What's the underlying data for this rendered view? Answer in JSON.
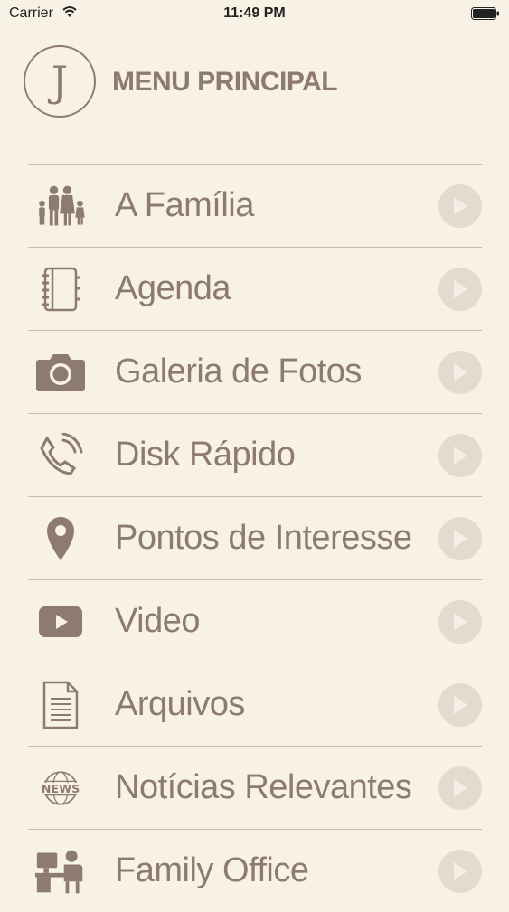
{
  "status_bar": {
    "carrier": "Carrier",
    "time": "11:49 PM"
  },
  "header": {
    "logo_letter": "J",
    "title": "MENU PRINCIPAL"
  },
  "menu": {
    "items": [
      {
        "label": "A Família",
        "icon": "family-icon"
      },
      {
        "label": "Agenda",
        "icon": "notebook-icon"
      },
      {
        "label": "Galeria de Fotos",
        "icon": "camera-icon"
      },
      {
        "label": "Disk Rápido",
        "icon": "phone-icon"
      },
      {
        "label": "Pontos de Interesse",
        "icon": "map-pin-icon"
      },
      {
        "label": "Video",
        "icon": "video-play-icon"
      },
      {
        "label": "Arquivos",
        "icon": "document-icon"
      },
      {
        "label": "Notícias Relevantes",
        "icon": "news-globe-icon",
        "icon_text": "NEWS"
      },
      {
        "label": "Family Office",
        "icon": "office-desk-icon"
      }
    ]
  },
  "colors": {
    "background": "#f8f1e5",
    "accent": "#8e7b70",
    "arrow_bg": "#e3dbcf",
    "arrow_fg": "#f4eee4",
    "divider": "#c9bcb0"
  }
}
